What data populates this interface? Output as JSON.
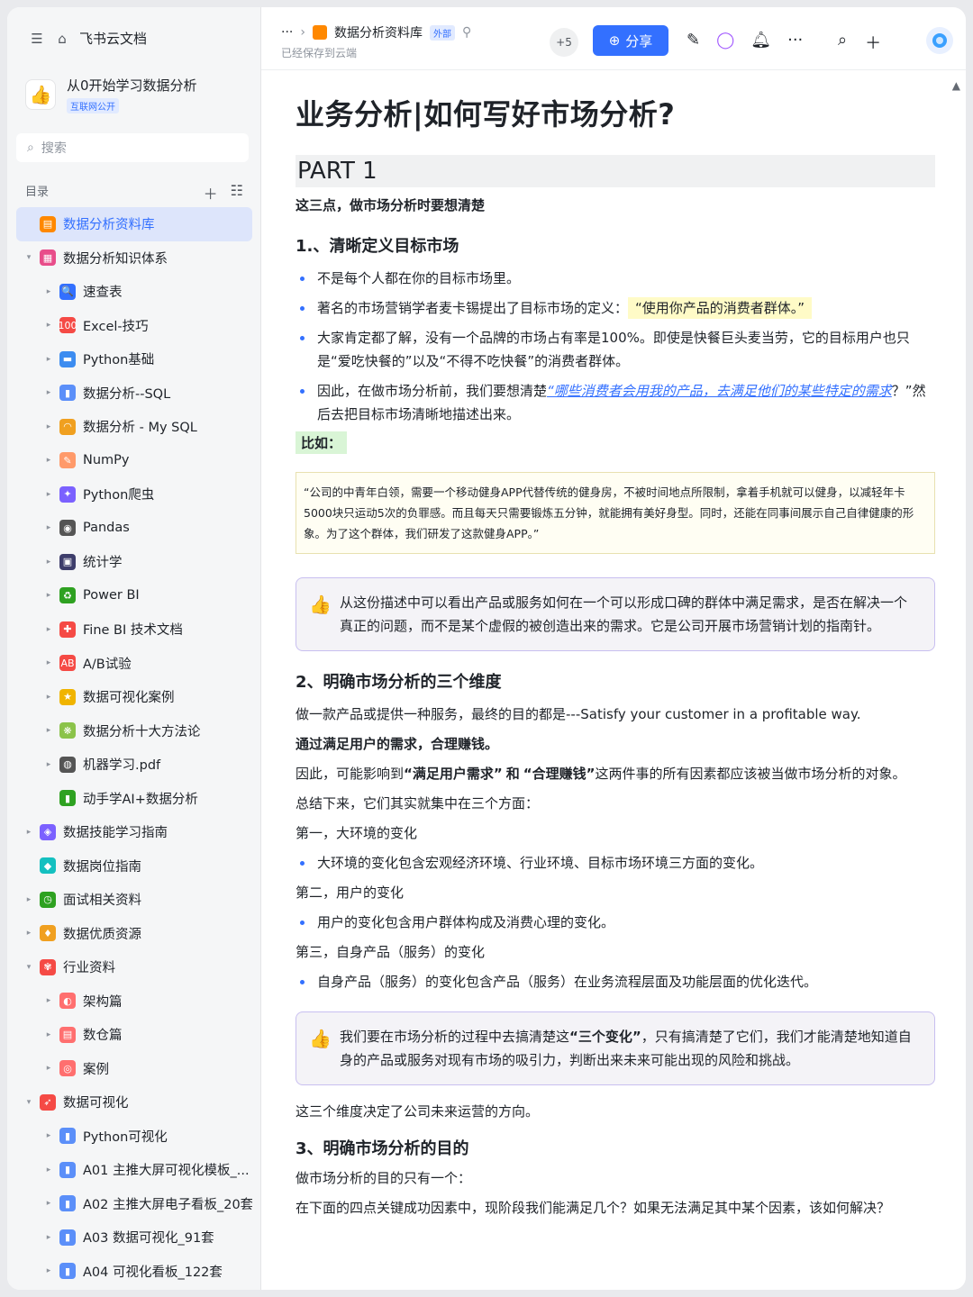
{
  "sidebar": {
    "app_title": "飞书云文档",
    "space_name": "从0开始学习数据分析",
    "space_badge": "互联网公开",
    "search_placeholder": "搜索",
    "toc_label": "目录",
    "items": [
      {
        "label": "数据分析资料库",
        "level": 0,
        "arrow": "",
        "color": "#ff8800",
        "glyph": "▤",
        "active": true
      },
      {
        "label": "数据分析知识体系",
        "level": 0,
        "arrow": "▾",
        "color": "#e84d8a",
        "glyph": "▦"
      },
      {
        "label": "速查表",
        "level": 1,
        "arrow": "▸",
        "color": "#3370ff",
        "glyph": "🔍"
      },
      {
        "label": "Excel-技巧",
        "level": 1,
        "arrow": "▸",
        "color": "#f54a45",
        "glyph": "100"
      },
      {
        "label": "Python基础",
        "level": 1,
        "arrow": "▸",
        "color": "#3c8cf0",
        "glyph": "▬"
      },
      {
        "label": "数据分析--SQL",
        "level": 1,
        "arrow": "▸",
        "color": "#5b8ff9",
        "glyph": "▮"
      },
      {
        "label": "数据分析 - My SQL",
        "level": 1,
        "arrow": "▸",
        "color": "#f0a020",
        "glyph": "◠"
      },
      {
        "label": "NumPy",
        "level": 1,
        "arrow": "▸",
        "color": "#ff9a6a",
        "glyph": "✎"
      },
      {
        "label": "Python爬虫",
        "level": 1,
        "arrow": "▸",
        "color": "#7b61ff",
        "glyph": "✦"
      },
      {
        "label": "Pandas",
        "level": 1,
        "arrow": "▸",
        "color": "#555555",
        "glyph": "◉"
      },
      {
        "label": "统计学",
        "level": 1,
        "arrow": "▸",
        "color": "#3d3d6b",
        "glyph": "▣"
      },
      {
        "label": "Power BI",
        "level": 1,
        "arrow": "▸",
        "color": "#2ea121",
        "glyph": "♻"
      },
      {
        "label": "Fine BI 技术文档",
        "level": 1,
        "arrow": "▸",
        "color": "#f54a45",
        "glyph": "✚"
      },
      {
        "label": "A/B试验",
        "level": 1,
        "arrow": "▸",
        "color": "#f54a45",
        "glyph": "AB"
      },
      {
        "label": "数据可视化案例",
        "level": 1,
        "arrow": "▸",
        "color": "#f0b400",
        "glyph": "★"
      },
      {
        "label": "数据分析十大方法论",
        "level": 1,
        "arrow": "▸",
        "color": "#8bc34a",
        "glyph": "❋"
      },
      {
        "label": "机器学习.pdf",
        "level": 1,
        "arrow": "▸",
        "color": "#555555",
        "glyph": "◍"
      },
      {
        "label": "动手学AI+数据分析",
        "level": 1,
        "arrow": "",
        "color": "#2ea121",
        "glyph": "▮"
      },
      {
        "label": "数据技能学习指南",
        "level": 0,
        "arrow": "▸",
        "color": "#7b61ff",
        "glyph": "◈"
      },
      {
        "label": "数据岗位指南",
        "level": 0,
        "arrow": "",
        "color": "#14c0c0",
        "glyph": "◆"
      },
      {
        "label": "面试相关资料",
        "level": 0,
        "arrow": "▸",
        "color": "#2ea121",
        "glyph": "◷"
      },
      {
        "label": "数据优质资源",
        "level": 0,
        "arrow": "▸",
        "color": "#f0a020",
        "glyph": "♦"
      },
      {
        "label": "行业资料",
        "level": 0,
        "arrow": "▾",
        "color": "#f54a45",
        "glyph": "✾"
      },
      {
        "label": "架构篇",
        "level": 1,
        "arrow": "▸",
        "color": "#ff6f6f",
        "glyph": "◐"
      },
      {
        "label": "数仓篇",
        "level": 1,
        "arrow": "▸",
        "color": "#ff6f6f",
        "glyph": "▤"
      },
      {
        "label": "案例",
        "level": 1,
        "arrow": "▸",
        "color": "#ff6f6f",
        "glyph": "◎"
      },
      {
        "label": "数据可视化",
        "level": 0,
        "arrow": "▾",
        "color": "#f54a45",
        "glyph": "➶"
      },
      {
        "label": "Python可视化",
        "level": 1,
        "arrow": "▸",
        "color": "#5b8ff9",
        "glyph": "▮"
      },
      {
        "label": "A01 主推大屏可视化模板_...",
        "level": 1,
        "arrow": "▸",
        "color": "#5b8ff9",
        "glyph": "▮"
      },
      {
        "label": "A02 主推大屏电子看板_20套",
        "level": 1,
        "arrow": "▸",
        "color": "#5b8ff9",
        "glyph": "▮"
      },
      {
        "label": "A03 数据可视化_91套",
        "level": 1,
        "arrow": "▸",
        "color": "#5b8ff9",
        "glyph": "▮"
      },
      {
        "label": "A04 可视化看板_122套",
        "level": 1,
        "arrow": "▸",
        "color": "#5b8ff9",
        "glyph": "▮"
      }
    ]
  },
  "topbar": {
    "more": "···",
    "crumb": "数据分析资料库",
    "crumb_tag": "外部",
    "saved": "已经保存到云端",
    "collaborators": "+5",
    "share_label": "分享"
  },
  "doc": {
    "title": "业务分析|如何写好市场分析?",
    "part": "PART 1",
    "intro": "这三点，做市场分析时要想清楚",
    "h1": "1.、清晰定义目标市场",
    "b1": "不是每个人都在你的目标市场里。",
    "b2_pre": "著名的市场营销学者麦卡锡提出了目标市场的定义：",
    "b2_hl": "“使用你产品的消费者群体。”",
    "b3": "大家肯定都了解，没有一个品牌的市场占有率是100%。即使是快餐巨头麦当劳，它的目标用户也只是“爱吃快餐的”以及“不得不吃快餐”的消费者群体。",
    "b4_pre": "因此，在做市场分析前，我们要想清楚",
    "b4_link": "“哪些消费者会用我的产品，去满足他们的某些特定的需求",
    "b4_post": "？”然后去把目标市场清晰地描述出来。",
    "example_label": "比如：",
    "quote": "“公司的中青年白领，需要一个移动健身APP代替传统的健身房，不被时间地点所限制，拿着手机就可以健身，以减轻年卡5000块只运动5次的负罪感。而且每天只需要锻炼五分钟，就能拥有美好身型。同时，还能在同事间展示自己自律健康的形象。为了这个群体，我们研发了这款健身APP。”",
    "callout1": "从这份描述中可以看出产品或服务如何在一个可以形成口碑的群体中满足需求，是否在解决一个真正的问题，而不是某个虚假的被创造出来的需求。它是公司开展市场营销计划的指南针。",
    "h2": "2、明确市场分析的三个维度",
    "p1": "做一款产品或提供一种服务，最终的目的都是---Satisfy your customer in a profitable way.",
    "p2": "通过满足用户的需求，合理赚钱。",
    "p3_a": "因此，可能影响到",
    "p3_b": "“满足用户需求”",
    "p3_c": "和",
    "p3_d": "“合理赚钱”",
    "p3_e": "这两件事的所有因素都应该被当做市场分析的对象。",
    "p4": "总结下来，它们其实就集中在三个方面：",
    "p5": "第一，大环境的变化",
    "b5": "大环境的变化包含宏观经济环境、行业环境、目标市场环境三方面的变化。",
    "p6": "第二，用户的变化",
    "b6": "用户的变化包含用户群体构成及消费心理的变化。",
    "p7": "第三，自身产品（服务）的变化",
    "b7": "自身产品（服务）的变化包含产品（服务）在业务流程层面及功能层面的优化迭代。",
    "callout2_a": "我们要在市场分析的过程中去搞清楚这",
    "callout2_b": "“三个变化”",
    "callout2_c": "，只有搞清楚了它们，我们才能清楚地知道自身的产品或服务对现有市场的吸引力，判断出来未来可能出现的风险和挑战。",
    "p8": "这三个维度决定了公司未来运营的方向。",
    "h3": "3、明确市场分析的目的",
    "p9": "做市场分析的目的只有一个：",
    "p10": "在下面的四点关键成功因素中，现阶段我们能满足几个？如果无法满足其中某个因素，该如何解决？"
  }
}
